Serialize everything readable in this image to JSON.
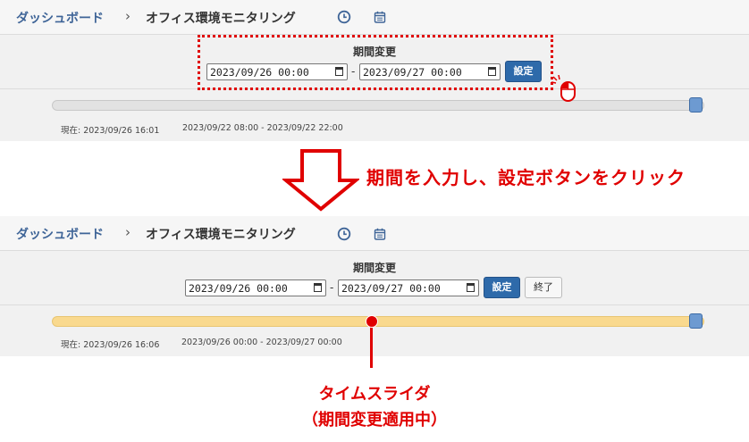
{
  "top": {
    "breadcrumb_link": "ダッシュボード",
    "breadcrumb_sep": "›",
    "breadcrumb_current": "オフィス環境モニタリング",
    "period_title": "期間変更",
    "from_value": "2023/09/26 00:00",
    "to_value": "2023/09/27 00:00",
    "dash": "-",
    "set_label": "設定",
    "status_now": "現在: 2023/09/26 16:01",
    "status_range": "2023/09/22 08:00 - 2023/09/22 22:00"
  },
  "bottom": {
    "breadcrumb_link": "ダッシュボード",
    "breadcrumb_sep": "›",
    "breadcrumb_current": "オフィス環境モニタリング",
    "period_title": "期間変更",
    "from_value": "2023/09/26 00:00",
    "to_value": "2023/09/27 00:00",
    "dash": "-",
    "set_label": "設定",
    "end_label": "終了",
    "status_now": "現在: 2023/09/26 16:06",
    "status_range": "2023/09/26 00:00 - 2023/09/27 00:00",
    "slider_fraction": 0.49
  },
  "annotations": {
    "instruction": "期間を入力し、設定ボタンをクリック",
    "slider_label_line1": "タイムスライダ",
    "slider_label_line2": "（期間変更適用中）"
  },
  "icons": {
    "history": "clock-icon",
    "calendar": "calendar-icon",
    "mouse": "mouse-icon",
    "arrow": "down-arrow"
  },
  "colors": {
    "accent": "#2e6aaa",
    "breadcrumb": "#3e6497",
    "annotation": "#e00000",
    "slider_active": "#f9d98e",
    "slider_handle": "#6d9ad1"
  }
}
